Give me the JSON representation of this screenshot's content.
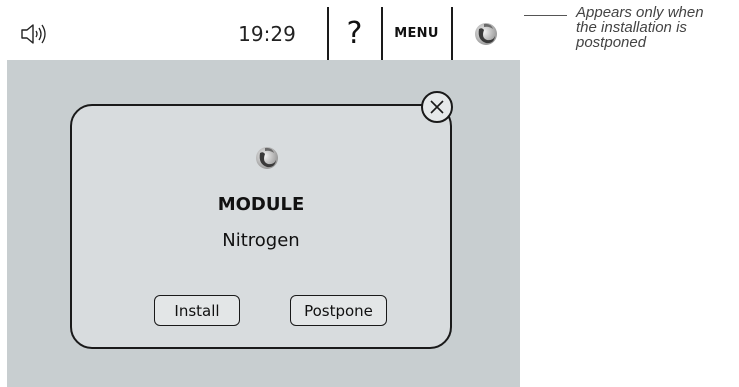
{
  "topbar": {
    "time": "19:29",
    "help_label": "?",
    "menu_label": "MENU",
    "speaker_icon": "speaker-icon",
    "logo_icon": "brand-swirl-icon"
  },
  "dialog": {
    "logo_icon": "brand-swirl-icon",
    "title": "MODULE",
    "subtitle": "Nitrogen",
    "install_label": "Install",
    "postpone_label": "Postpone",
    "close_icon": "close-icon"
  },
  "annotation": {
    "lines": [
      "Appears only when",
      "the installation is",
      "postponed"
    ]
  }
}
